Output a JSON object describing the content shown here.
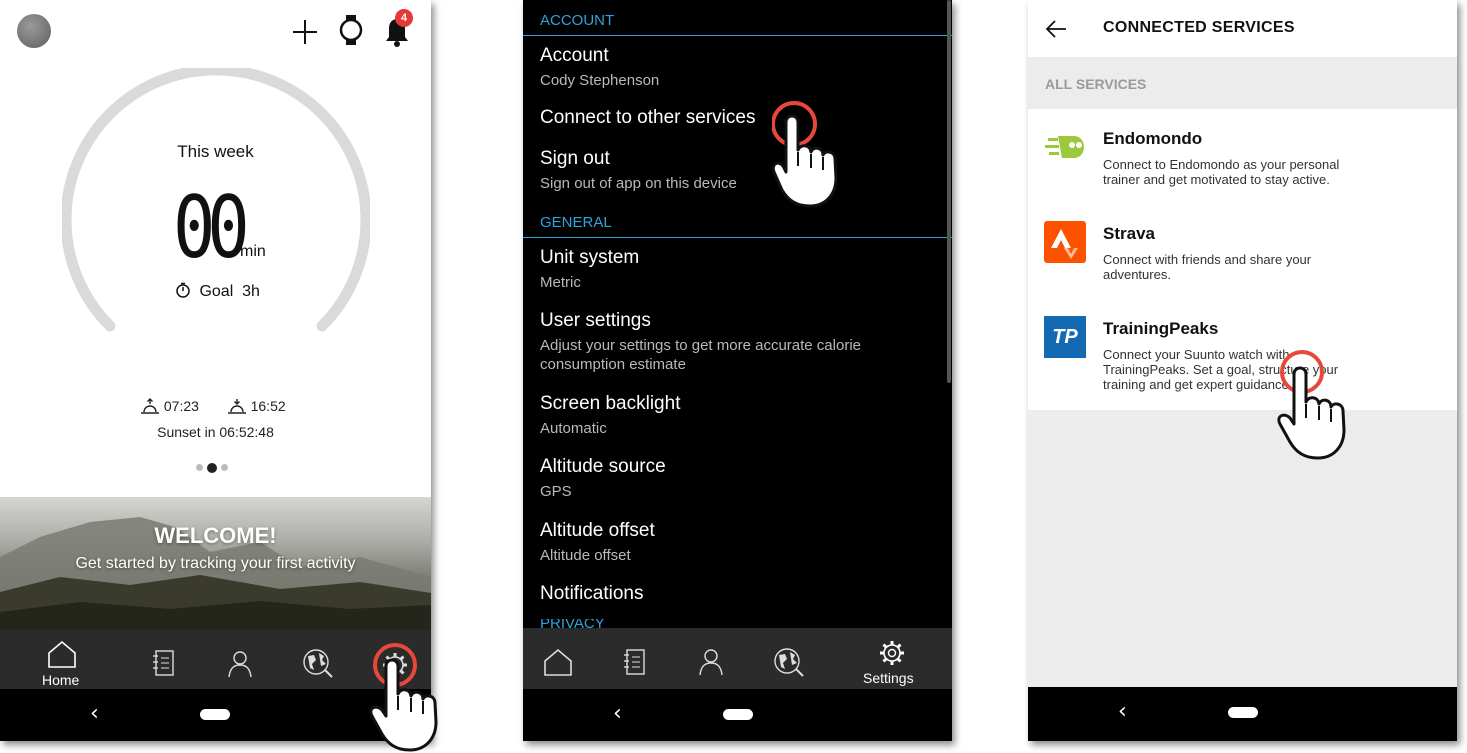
{
  "colors": {
    "accent_blue": "#2ea3dd",
    "tap_ring": "#e8483b",
    "endomondo_green": "#9bc93a",
    "strava_orange": "#fc5200",
    "trainingpeaks_blue": "#1469b3"
  },
  "home": {
    "notification_count": "4",
    "progress_this_week": 0,
    "period_label": "This week",
    "duration_value": "00",
    "duration_unit": "min",
    "goal_label": "Goal",
    "goal_value": "3h",
    "sunrise_time": "07:23",
    "sunset_time": "16:52",
    "sunset_countdown": "Sunset in 06:52:48",
    "page_count": 3,
    "active_page": 2,
    "welcome_title": "WELCOME!",
    "welcome_text": "Get started by tracking your first activity",
    "nav": {
      "home_label": "Home",
      "icons": [
        "home-icon",
        "diary-icon",
        "profile-icon",
        "globe-icon",
        "settings-icon"
      ]
    }
  },
  "settings": {
    "sections": {
      "account": "ACCOUNT",
      "general": "GENERAL",
      "privacy": "PRIVACY"
    },
    "items": [
      {
        "title": "Account",
        "subtitle": "Cody Stephenson"
      },
      {
        "title": "Connect to other services",
        "subtitle": ""
      },
      {
        "title": "Sign out",
        "subtitle": "Sign out of app on this device"
      },
      {
        "title": "Unit system",
        "subtitle": "Metric"
      },
      {
        "title": "User settings",
        "subtitle": "Adjust your settings to get more accurate calorie consumption estimate"
      },
      {
        "title": "Screen backlight",
        "subtitle": "Automatic"
      },
      {
        "title": "Altitude source",
        "subtitle": "GPS"
      },
      {
        "title": "Altitude offset",
        "subtitle": "Altitude offset"
      },
      {
        "title": "Notifications",
        "subtitle": ""
      }
    ],
    "nav": {
      "settings_label": "Settings"
    }
  },
  "connected_services": {
    "title": "CONNECTED SERVICES",
    "section_label": "ALL SERVICES",
    "services": [
      {
        "name": "Endomondo",
        "description": "Connect to Endomondo as your personal trainer and get motivated to stay active.",
        "logo_text": ""
      },
      {
        "name": "Strava",
        "description": "Connect with friends and share your adventures.",
        "logo_text": ""
      },
      {
        "name": "TrainingPeaks",
        "description": "Connect your Suunto watch with TrainingPeaks. Set a goal, structure your training and get expert guidance.",
        "logo_text": "TP"
      }
    ]
  }
}
